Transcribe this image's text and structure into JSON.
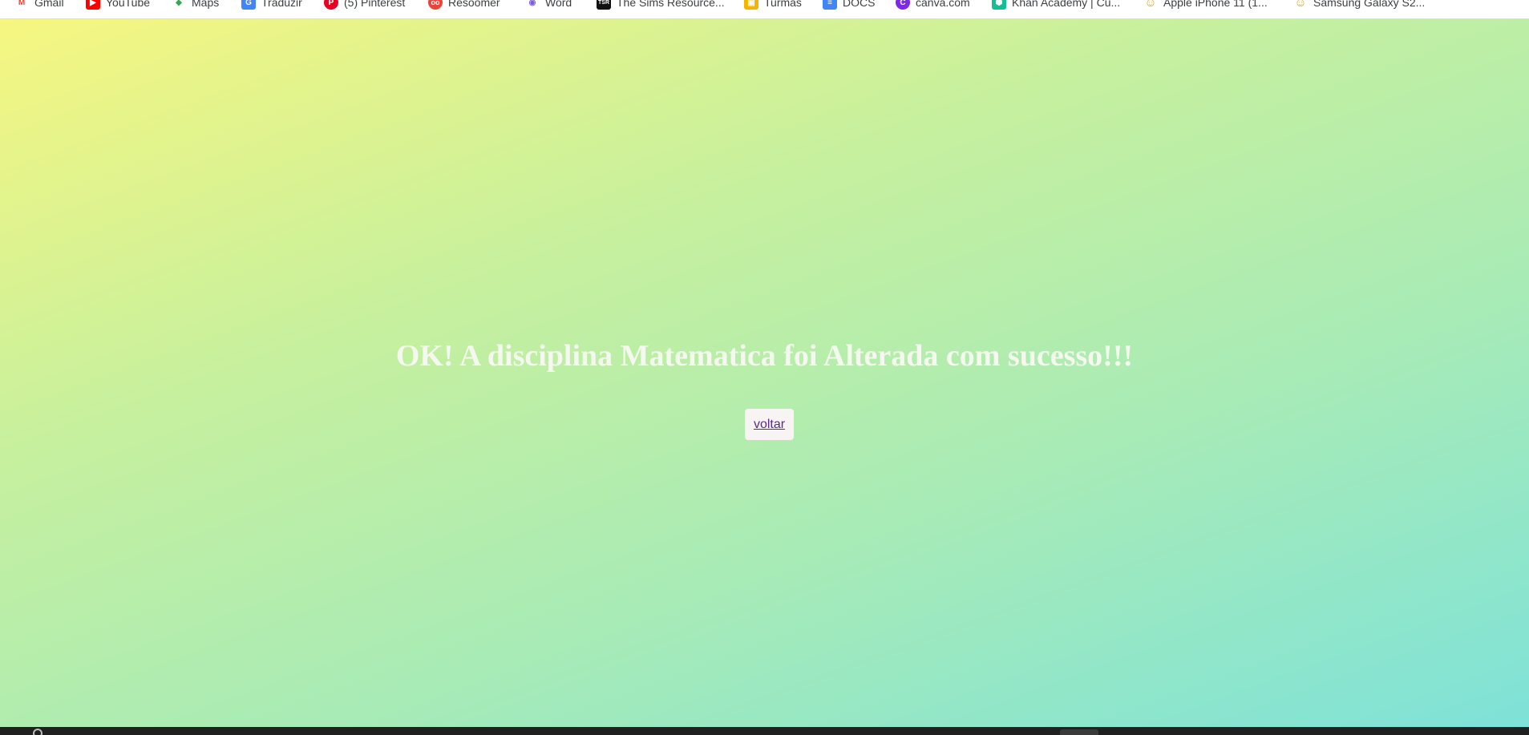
{
  "bookmarks": [
    {
      "label": "Gmail",
      "icon": "gmail-icon",
      "color": "#ea4335",
      "glyph": "M"
    },
    {
      "label": "YouTube",
      "icon": "youtube-icon",
      "color": "#ff0000",
      "glyph": "▶"
    },
    {
      "label": "Maps",
      "icon": "maps-icon",
      "color": "#34a853",
      "glyph": "◆"
    },
    {
      "label": "Traduzir",
      "icon": "translate-icon",
      "color": "#4285f4",
      "glyph": "G"
    },
    {
      "label": "(5) Pinterest",
      "icon": "pinterest-icon",
      "color": "#e60023",
      "glyph": "P"
    },
    {
      "label": "Resoomer",
      "icon": "resoomer-icon",
      "color": "#e8453c",
      "glyph": "oo"
    },
    {
      "label": "Word",
      "icon": "word-icon",
      "color": "#7b5cd6",
      "glyph": "◉"
    },
    {
      "label": "The Sims Resource...",
      "icon": "tsr-icon",
      "color": "#111111",
      "glyph": "TSR"
    },
    {
      "label": "Turmas",
      "icon": "classroom-icon",
      "color": "#f4b400",
      "glyph": "▣"
    },
    {
      "label": "DOCS",
      "icon": "docs-icon",
      "color": "#4285f4",
      "glyph": "≡"
    },
    {
      "label": "canva.com",
      "icon": "canva-icon",
      "color": "#7d2ae8",
      "glyph": "C"
    },
    {
      "label": "Khan Academy | Cu...",
      "icon": "khan-academy-icon",
      "color": "#14bf96",
      "glyph": "⬢"
    },
    {
      "label": "Apple iPhone 11 (1...",
      "icon": "smiley-icon",
      "color": "#d4a72c",
      "glyph": "☺"
    },
    {
      "label": "Samsung Galaxy S2...",
      "icon": "smiley-icon",
      "color": "#d4a72c",
      "glyph": "☺"
    }
  ],
  "message": {
    "ok": "OK!",
    "text": " A disciplina Matematica foi Alterada com sucesso!!!"
  },
  "back_button": {
    "label": "voltar"
  }
}
